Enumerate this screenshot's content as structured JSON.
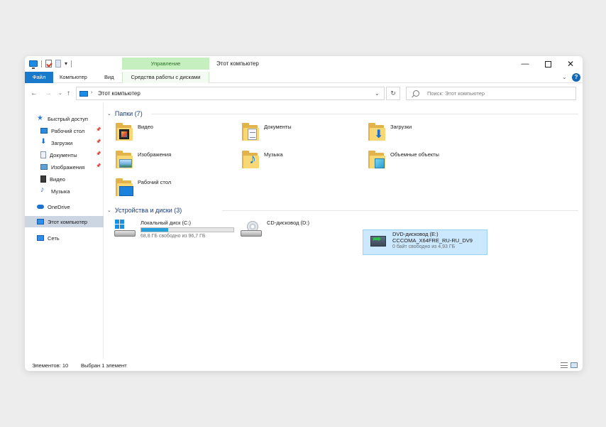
{
  "window": {
    "title": "Этот компьютер",
    "context_tab": "Управление"
  },
  "ribbon": {
    "tabs": [
      "Файл",
      "Компьютер",
      "Вид",
      "Средства работы с дисками"
    ],
    "min_label": "—",
    "close_label": "✕",
    "help_label": "?",
    "collapse_label": "⌄"
  },
  "address": {
    "back": "←",
    "forward": "→",
    "recent": "⌄",
    "up": "↑",
    "chevron": "›",
    "path": "Этот компьютер",
    "dropdown": "⌄",
    "refresh": "↻",
    "search_placeholder": "Поиск: Этот компьютер"
  },
  "sidebar": {
    "quick_access": "Быстрый доступ",
    "items": [
      {
        "label": "Рабочий стол",
        "pinned": true,
        "icon": "desktop-icon"
      },
      {
        "label": "Загрузки",
        "pinned": true,
        "icon": "downloads-icon"
      },
      {
        "label": "Документы",
        "pinned": true,
        "icon": "documents-icon"
      },
      {
        "label": "Изображения",
        "pinned": true,
        "icon": "pictures-icon"
      },
      {
        "label": "Видео",
        "pinned": false,
        "icon": "video-icon"
      },
      {
        "label": "Музыка",
        "pinned": false,
        "icon": "music-icon"
      }
    ],
    "pin_glyph": "📌",
    "onedrive": "OneDrive",
    "this_pc": "Этот компьютер",
    "network": "Сеть"
  },
  "folders": {
    "header": "Папки (7)",
    "items": [
      "Видео",
      "Документы",
      "Загрузки",
      "Изображения",
      "Музыка",
      "Объемные объекты",
      "Рабочий стол"
    ]
  },
  "devices": {
    "header": "Устройства и диски (3)",
    "local": {
      "name": "Локальный диск (C:)",
      "free": "68,8 ГБ свободно из 96,7 ГБ",
      "used_fraction": 0.29
    },
    "cd": {
      "name": "CD-дисковод (D:)"
    },
    "dvd": {
      "name": "DVD-дисковод (E:)",
      "label": "CCCOMA_X64FRE_RU-RU_DV9",
      "free": "0 байт свободно из 4,93 ГБ"
    }
  },
  "status": {
    "count": "Элементов: 10",
    "selected": "Выбран 1 элемент"
  },
  "colors": {
    "accent": "#1979ca",
    "manage_tab": "#c6efbf",
    "selection": "#cce8ff",
    "drive_bar": "#26a0da"
  }
}
